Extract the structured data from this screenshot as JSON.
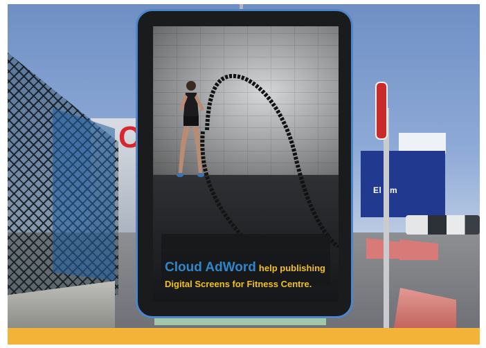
{
  "billboard": {
    "brand": "Cloud AdWord",
    "tagline_line1": "help publishing",
    "tagline_line2": "Digital Screens for Fitness Centre."
  },
  "background": {
    "store_sign_left": "C",
    "store_sign_right": "El    om"
  },
  "colors": {
    "brand_blue": "#2f87c9",
    "tagline_yellow": "#f3c11b",
    "bottom_bar": "#f2b338",
    "bezel": "#4f86c9"
  }
}
